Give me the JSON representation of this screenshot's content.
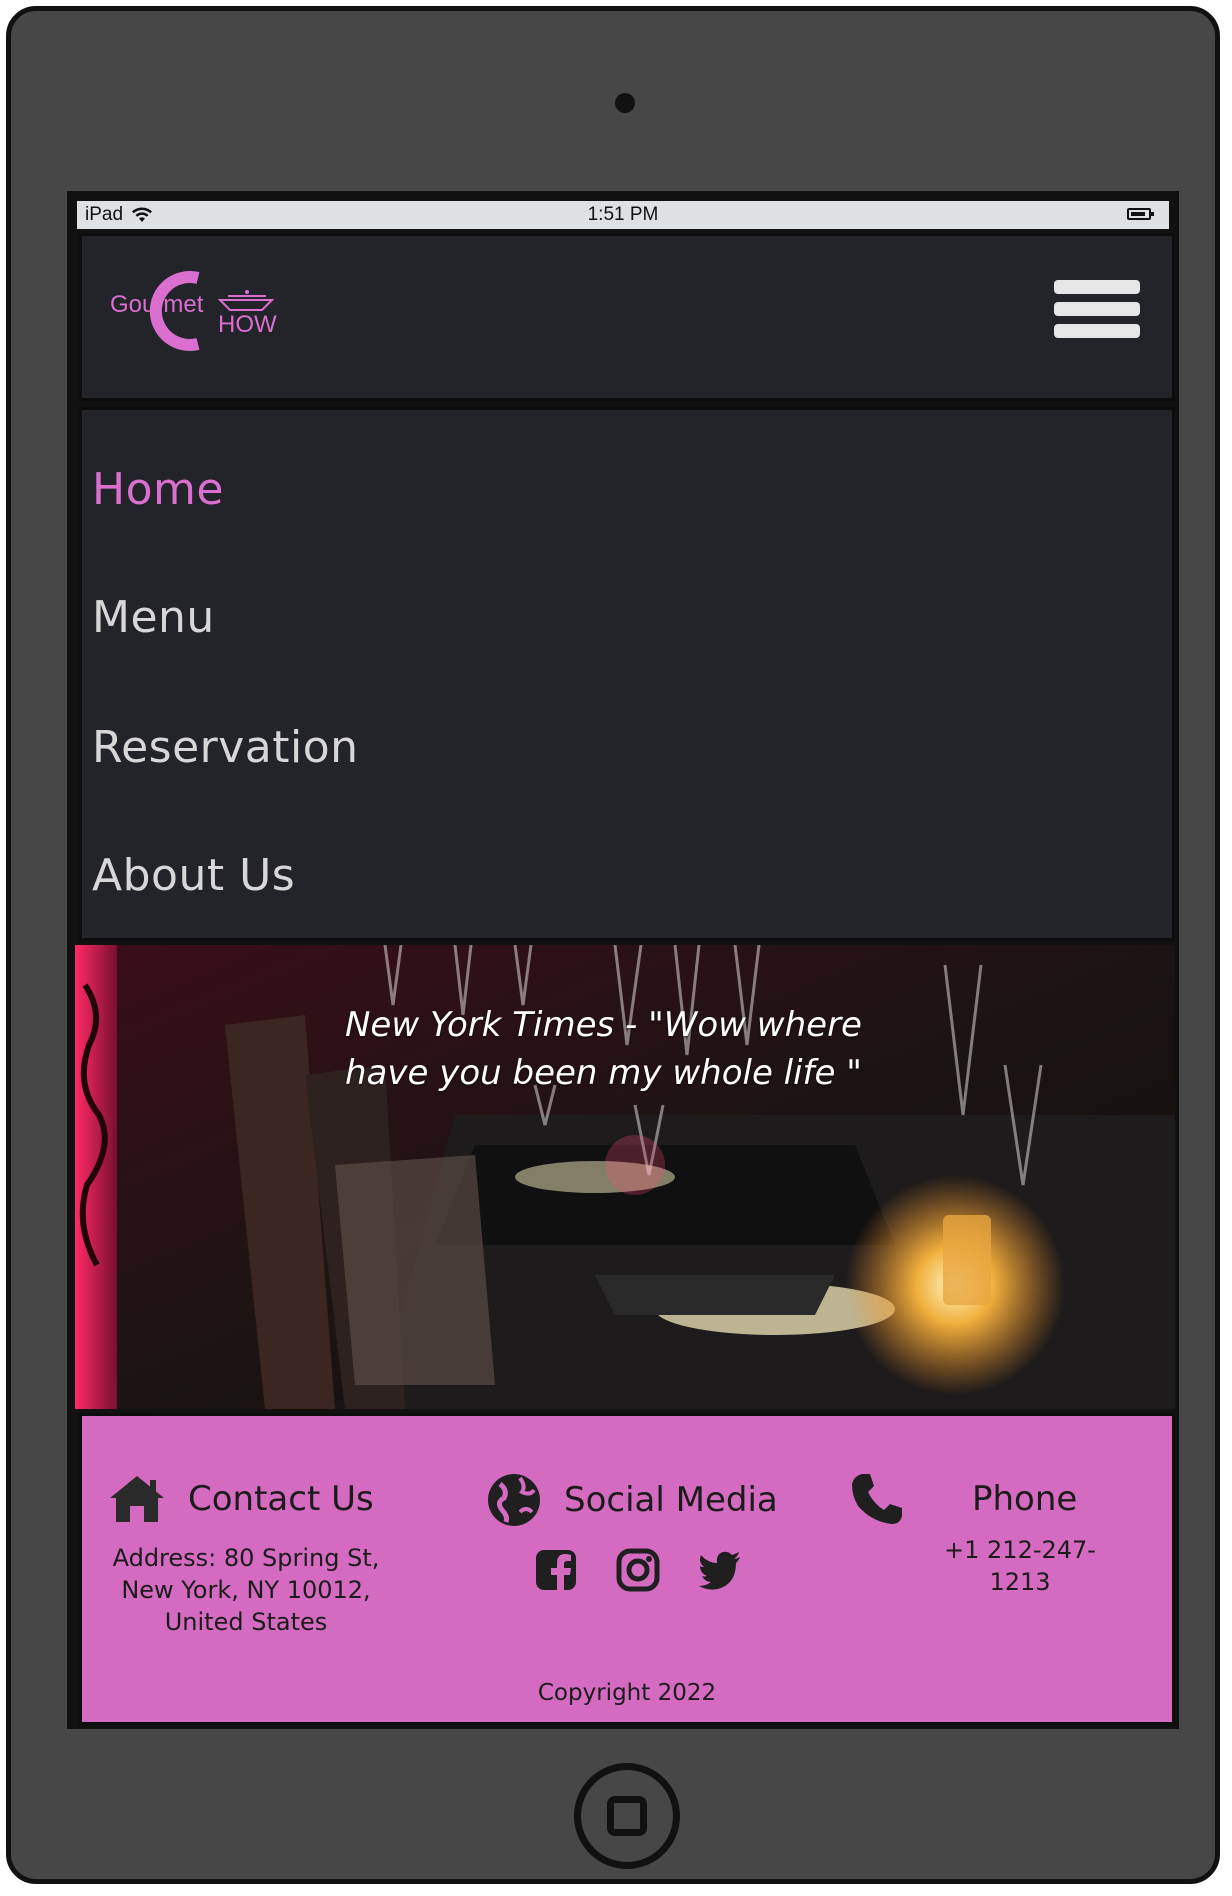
{
  "status_bar": {
    "device": "iPad",
    "time": "1:51 PM"
  },
  "brand": {
    "logo_text_1": "Gourmet",
    "logo_text_2": "HOW",
    "logo_letter": "C",
    "accent_color": "#da6fcf"
  },
  "nav": {
    "items": [
      {
        "label": "Home",
        "active": true
      },
      {
        "label": "Menu",
        "active": false
      },
      {
        "label": "Reservation",
        "active": false
      },
      {
        "label": "About Us",
        "active": false
      }
    ]
  },
  "hero": {
    "quote_line_1": "New York Times - \"Wow where",
    "quote_line_2": "have you been my whole life \""
  },
  "footer": {
    "background": "#d46bc1",
    "contact": {
      "title": "Contact Us",
      "icon": "home-icon",
      "address": "Address: 80 Spring St, New York, NY 10012, United States"
    },
    "social": {
      "title": "Social Media",
      "icon": "globe-icon",
      "links": [
        "facebook-icon",
        "instagram-icon",
        "twitter-icon"
      ]
    },
    "phone": {
      "title": "Phone",
      "icon": "phone-icon",
      "number": "+1 212-247-1213"
    },
    "copyright": "Copyright 2022"
  }
}
